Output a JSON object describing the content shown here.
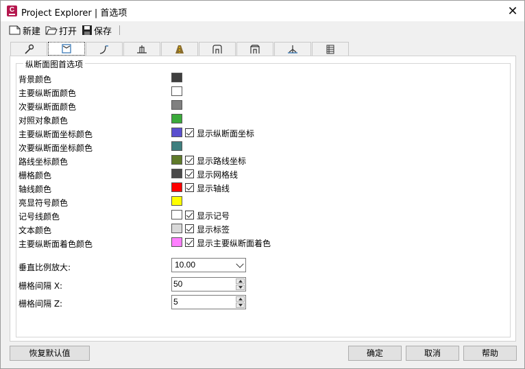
{
  "window": {
    "title": "Project Explorer | 首选项",
    "app_icon_letter": "C"
  },
  "toolbar": {
    "new_label": "新建",
    "open_label": "打开",
    "save_label": "保存"
  },
  "tabs": [
    {
      "icon": "wrench-icon"
    },
    {
      "icon": "profile-view-icon"
    },
    {
      "icon": "alignment-icon"
    },
    {
      "icon": "assembly-icon"
    },
    {
      "icon": "corridor-icon"
    },
    {
      "icon": "structure-icon"
    },
    {
      "icon": "pipe-network-icon"
    },
    {
      "icon": "cross-section-icon"
    },
    {
      "icon": "table-icon"
    }
  ],
  "group_title": "纵断面图首选项",
  "rows": [
    {
      "label": "背景颜色",
      "color": "#3f3f3f"
    },
    {
      "label": "主要纵断面颜色",
      "color": "#ffffff"
    },
    {
      "label": "次要纵断面颜色",
      "color": "#808080"
    },
    {
      "label": "对照对象颜色",
      "color": "#3aaa3a"
    },
    {
      "label": "主要纵断面坐标颜色",
      "color": "#5a4fcf",
      "checkbox": "显示纵断面坐标"
    },
    {
      "label": "次要纵断面坐标颜色",
      "color": "#3f7f7f"
    },
    {
      "label": "路线坐标颜色",
      "color": "#5f7a2a",
      "checkbox": "显示路线坐标"
    },
    {
      "label": "栅格颜色",
      "color": "#4a4a4a",
      "checkbox": "显示网格线"
    },
    {
      "label": "轴线颜色",
      "color": "#ff0000",
      "checkbox": "显示轴线"
    },
    {
      "label": "亮显符号颜色",
      "color": "#ffff00"
    },
    {
      "label": "记号线颜色",
      "color": "#ffffff",
      "checkbox": "显示记号"
    },
    {
      "label": "文本颜色",
      "color": "#d9d9d9",
      "checkbox": "显示标签"
    },
    {
      "label": "主要纵断面着色颜色",
      "color": "#ff80ff",
      "checkbox": "显示主要纵断面着色"
    }
  ],
  "vertical_scale": {
    "label": "垂直比例放大:",
    "value": "10.00"
  },
  "grid_x": {
    "label": "栅格间隔 X:",
    "value": "50"
  },
  "grid_z": {
    "label": "栅格间隔 Z:",
    "value": "5"
  },
  "buttons": {
    "restore": "恢复默认值",
    "ok": "确定",
    "cancel": "取消",
    "help": "帮助"
  }
}
